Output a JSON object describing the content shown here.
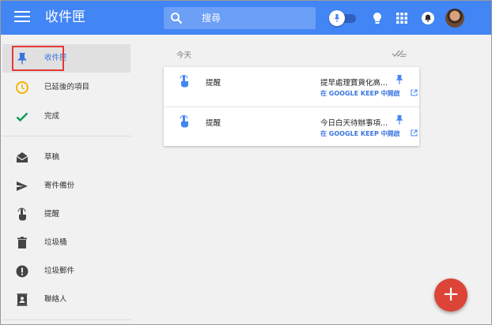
{
  "header": {
    "title": "收件匣",
    "search": {
      "placeholder": "搜尋"
    },
    "icons": [
      "menu-icon",
      "search-icon",
      "pin-toggle",
      "bulb-icon",
      "apps-grid-icon",
      "notifications-icon",
      "avatar"
    ],
    "colors": {
      "bar": "#4285f4",
      "search_bg": "#6c9ff6"
    }
  },
  "sidebar": {
    "items": [
      {
        "label": "收件匣",
        "icon": "pin-icon",
        "active": true
      },
      {
        "label": "已延後的項目",
        "icon": "clock-icon"
      },
      {
        "label": "完成",
        "icon": "check-icon"
      },
      {
        "label": "草稿",
        "icon": "drafts-icon"
      },
      {
        "label": "寄件備份",
        "icon": "send-icon"
      },
      {
        "label": "提醒",
        "icon": "reminder-finger-icon"
      },
      {
        "label": "垃圾桶",
        "icon": "trash-icon"
      },
      {
        "label": "垃圾郵件",
        "icon": "spam-icon"
      },
      {
        "label": "聯絡人",
        "icon": "contacts-icon"
      }
    ],
    "colors": {
      "active_text": "#3b74e0",
      "clock": "#f4b400",
      "check": "#0f9d58"
    }
  },
  "main": {
    "section_label": "今天",
    "cards": [
      {
        "type": "提醒",
        "text": "提早處理寶貨化高...",
        "link": "在 GOOGLE KEEP 中開啟"
      },
      {
        "type": "提醒",
        "text": "今日白天待辦事項...",
        "link": "在 GOOGLE KEEP 中開啟"
      }
    ]
  },
  "fab": {
    "label": "+",
    "color": "#db4437"
  }
}
